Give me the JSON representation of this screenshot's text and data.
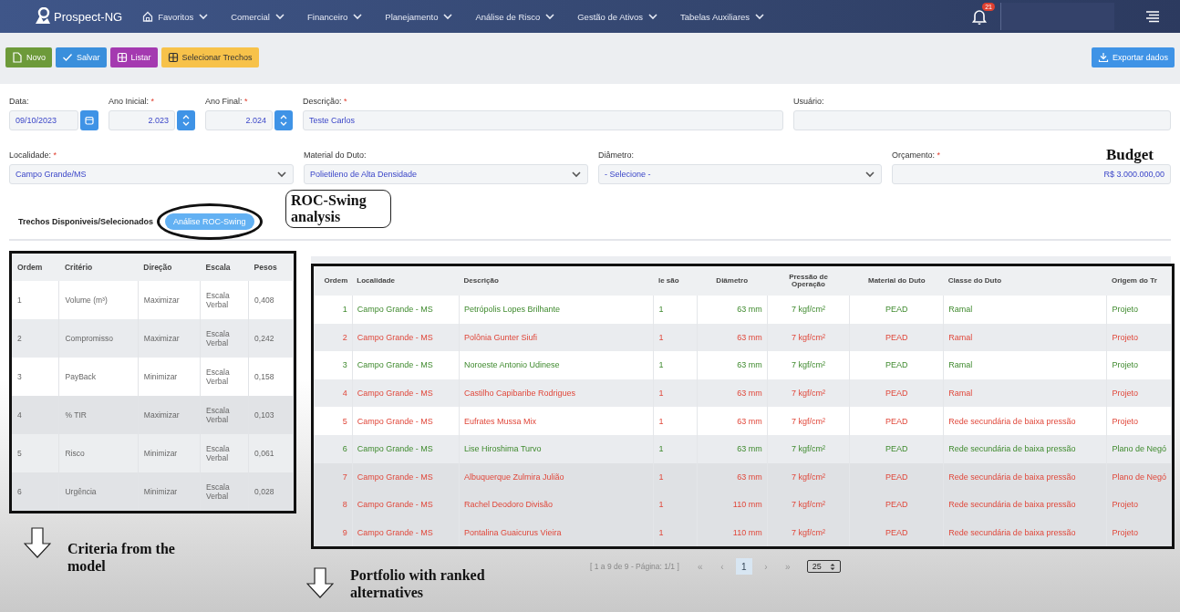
{
  "app": {
    "name": "Prospect-NG",
    "notifications": "21"
  },
  "menu": [
    {
      "label": "Favoritos",
      "kind": "home"
    },
    {
      "label": "Comercial",
      "kind": "plain"
    },
    {
      "label": "Financeiro",
      "kind": "plain"
    },
    {
      "label": "Planejamento",
      "kind": "plain"
    },
    {
      "label": "Análise de Risco",
      "kind": "plain"
    },
    {
      "label": "Gestão de Ativos",
      "kind": "plain"
    },
    {
      "label": "Tabelas Auxiliares",
      "kind": "plain"
    }
  ],
  "toolbar": [
    {
      "label": "Novo",
      "kind": "new"
    },
    {
      "label": "Salvar",
      "kind": "save"
    },
    {
      "label": "Listar",
      "kind": "list"
    },
    {
      "label": "Selecionar Trechos",
      "kind": "select"
    }
  ],
  "export_button": "Exportar dados",
  "form_rows": [
    [
      {
        "label": "Data:",
        "kind": "date",
        "value": "09/10/2023"
      },
      {
        "label": "Ano Inicial:",
        "kind": "number",
        "value": "2.023",
        "required_mark": "*"
      },
      {
        "label": "Ano Final:",
        "kind": "number",
        "value": "2.024",
        "required_mark": "*"
      },
      {
        "label": "Descrição:",
        "kind": "text",
        "value": "Teste Carlos",
        "required_mark": "*"
      },
      {
        "label": "Usuário:",
        "kind": "text"
      }
    ],
    [
      {
        "label": "Localidade:",
        "kind": "select",
        "value": "Campo Grande/MS",
        "required_mark": "*"
      },
      {
        "label": "Material do Duto:",
        "kind": "select",
        "value": "Polietileno de Alta Densidade"
      },
      {
        "label": "Diâmetro:",
        "kind": "select",
        "value": "- Selecione -"
      },
      {
        "label": "Orçamento:",
        "kind": "currency",
        "value": "R$ 3.000.000,00",
        "required_mark": "*"
      }
    ]
  ],
  "tabs": [
    {
      "label": "Trechos Disponiveis/Selecionados",
      "selected": false
    },
    {
      "label": "Análise ROC-Swing",
      "selected": true
    }
  ],
  "criteria": {
    "columns": [
      "Ordem",
      "Critério",
      "Direção",
      "Escala",
      "Pesos"
    ],
    "rows": [
      [
        "1",
        "Volume (m³)",
        "Maximizar",
        "Escala Verbal",
        "0,408"
      ],
      [
        "2",
        "Compromisso",
        "Maximizar",
        "Escala Verbal",
        "0,242"
      ],
      [
        "3",
        "PayBack",
        "Minimizar",
        "Escala Verbal",
        "0,158"
      ],
      [
        "4",
        "% TIR",
        "Maximizar",
        "Escala Verbal",
        "0,103"
      ],
      [
        "5",
        "Risco",
        "Minimizar",
        "Escala Verbal",
        "0,061"
      ],
      [
        "6",
        "Urgência",
        "Minimizar",
        "Escala Verbal",
        "0,028"
      ]
    ]
  },
  "portfolio": {
    "columns": [
      "Ordem",
      "Localidade",
      "Descrição",
      "le são",
      "Diâmetro",
      "Pressão de Operação",
      "Material do Duto",
      "Classe do Duto",
      "Origem do Tr"
    ],
    "rows": [
      {
        "selected": true,
        "cells": [
          "1",
          "Campo Grande - MS",
          "Petrópolis Lopes Brilhante",
          "1",
          "63 mm",
          "7 kgf/cm²",
          "PEAD",
          "Ramal",
          "Projeto"
        ]
      },
      {
        "selected": false,
        "cells": [
          "2",
          "Campo Grande - MS",
          "Polônia Gunter Siufi",
          "1",
          "63 mm",
          "7 kgf/cm²",
          "PEAD",
          "Ramal",
          "Projeto"
        ]
      },
      {
        "selected": true,
        "cells": [
          "3",
          "Campo Grande - MS",
          "Noroeste Antonio Udinese",
          "1",
          "63 mm",
          "7 kgf/cm²",
          "PEAD",
          "Ramal",
          "Projeto"
        ]
      },
      {
        "selected": false,
        "cells": [
          "4",
          "Campo Grande - MS",
          "Castilho Capibaribe Rodrigues",
          "1",
          "63 mm",
          "7 kgf/cm²",
          "PEAD",
          "Ramal",
          "Projeto"
        ]
      },
      {
        "selected": false,
        "cells": [
          "5",
          "Campo Grande - MS",
          "Eufrates Mussa Mix",
          "1",
          "63 mm",
          "7 kgf/cm²",
          "PEAD",
          "Rede secundária de baixa pressão",
          "Projeto"
        ]
      },
      {
        "selected": true,
        "cells": [
          "6",
          "Campo Grande - MS",
          "Lise Hiroshima Turvo",
          "1",
          "63 mm",
          "7 kgf/cm²",
          "PEAD",
          "Rede secundária de baixa pressão",
          "Plano de Negó"
        ]
      },
      {
        "selected": false,
        "cells": [
          "7",
          "Campo Grande - MS",
          "Albuquerque Zulmira Julião",
          "1",
          "63 mm",
          "7 kgf/cm²",
          "PEAD",
          "Rede secundária de baixa pressão",
          "Plano de Negó"
        ]
      },
      {
        "selected": false,
        "cells": [
          "8",
          "Campo Grande - MS",
          "Rachel Deodoro Divisão",
          "1",
          "110 mm",
          "7 kgf/cm²",
          "PEAD",
          "Rede secundária de baixa pressão",
          "Projeto"
        ]
      },
      {
        "selected": false,
        "cells": [
          "9",
          "Campo Grande - MS",
          "Pontalina Guaicurus Vieira",
          "1",
          "110 mm",
          "7 kgf/cm²",
          "PEAD",
          "Rede secundária de baixa pressão",
          "Projeto"
        ]
      }
    ]
  },
  "pagination": {
    "summary": "[ 1 a 9 de 9 - Página: 1/1 ]",
    "pages": [
      {
        "label": "«",
        "selected": false
      },
      {
        "label": "‹",
        "selected": false
      },
      {
        "label": "1",
        "selected": true
      },
      {
        "label": "›",
        "selected": false
      },
      {
        "label": "»",
        "selected": false
      }
    ],
    "page_size": "25"
  },
  "annotations": [
    {
      "kind": "callout",
      "text": "ROC-Swing analysis"
    },
    {
      "kind": "label",
      "text": "Budget"
    },
    {
      "kind": "arrow",
      "text": "Criteria from the model"
    },
    {
      "kind": "arrow",
      "text": "Portfolio with ranked alternatives"
    }
  ]
}
